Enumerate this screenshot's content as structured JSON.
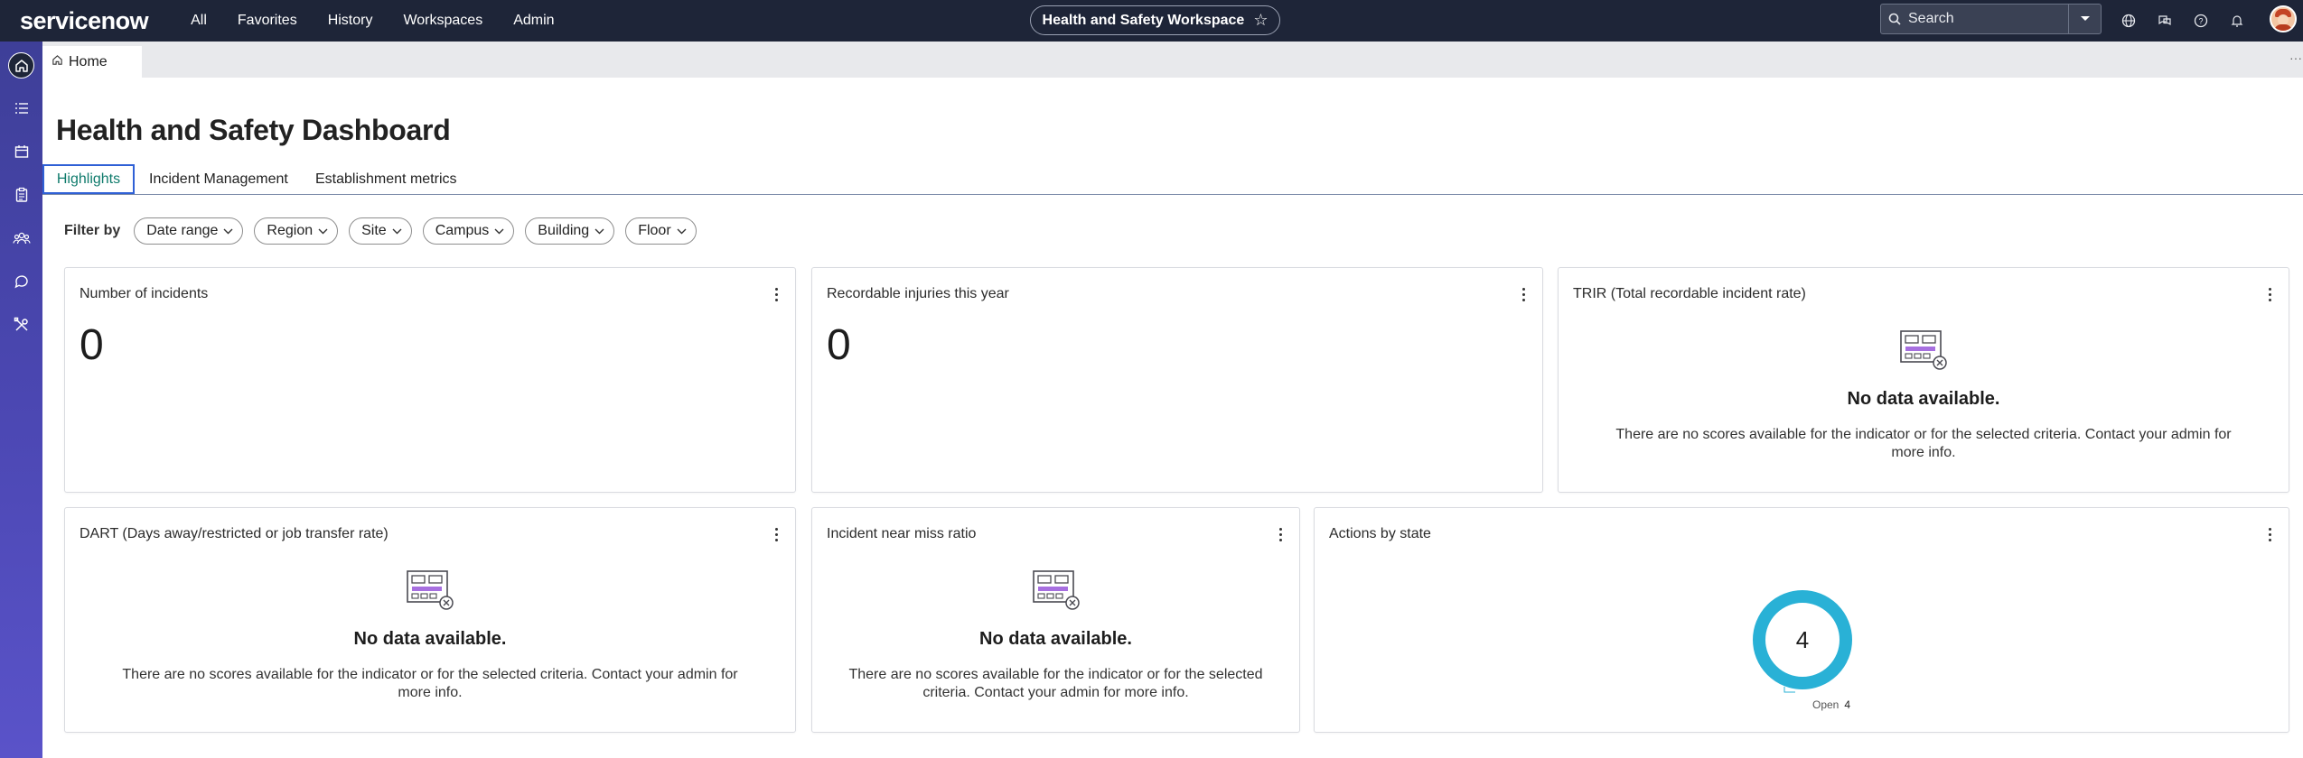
{
  "app": {
    "logo_text": "servicenow",
    "nav": [
      "All",
      "Favorites",
      "History",
      "Workspaces",
      "Admin"
    ],
    "workspace_title": "Health and Safety Workspace",
    "search_placeholder": "Search"
  },
  "tabstrip": {
    "home_label": "Home"
  },
  "page": {
    "title": "Health and Safety Dashboard",
    "tabs": [
      "Highlights",
      "Incident Management",
      "Establishment metrics"
    ],
    "filter_label": "Filter by",
    "filters": [
      "Date range",
      "Region",
      "Site",
      "Campus",
      "Building",
      "Floor"
    ]
  },
  "cards": {
    "incidents": {
      "title": "Number of incidents",
      "value": "0"
    },
    "recordable": {
      "title": "Recordable injuries this year",
      "value": "0"
    },
    "trir": {
      "title": "TRIR (Total recordable incident rate)",
      "nodata_title": "No data available.",
      "nodata_msg": "There are no scores available for the indicator or for the selected criteria. Contact your admin for more info."
    },
    "dart": {
      "title": "DART (Days away/restricted or job transfer rate)",
      "nodata_title": "No data available.",
      "nodata_msg": "There are no scores available for the indicator or for the selected criteria. Contact your admin for more info."
    },
    "near_miss": {
      "title": "Incident near miss ratio",
      "nodata_title": "No data available.",
      "nodata_msg": "There are no scores available for the indicator or for the selected criteria. Contact your admin for more info."
    },
    "actions": {
      "title": "Actions by state",
      "total": "4",
      "legend_label": "Open",
      "legend_value": "4"
    }
  },
  "chart_data": {
    "type": "pie",
    "title": "Actions by state",
    "categories": [
      "Open"
    ],
    "values": [
      4
    ],
    "donut": true,
    "center_label": "4",
    "colors": [
      "#29b1d6"
    ]
  },
  "colors": {
    "nav_bg": "#1e2538",
    "rail": "#4b47b2",
    "accent": "#2f60d6",
    "donut": "#29b1d6"
  }
}
